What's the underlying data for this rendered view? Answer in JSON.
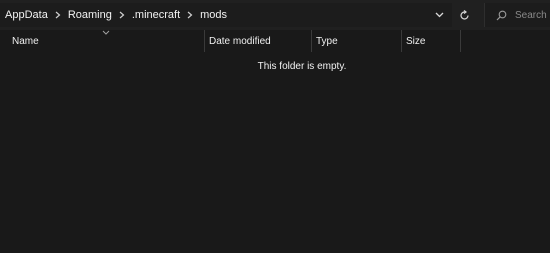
{
  "address_bar": {
    "crumbs": [
      "AppData",
      "Roaming",
      ".minecraft",
      "mods"
    ]
  },
  "search": {
    "placeholder": "Search m"
  },
  "columns": {
    "name": "Name",
    "date_modified": "Date modified",
    "type": "Type",
    "size": "Size"
  },
  "content": {
    "empty_message": "This folder is empty."
  },
  "icons": {
    "separator": "chevron-right-icon",
    "dropdown": "chevron-down-icon",
    "refresh": "refresh-icon",
    "search": "search-icon",
    "sort": "sort-chevron-icon"
  },
  "colors": {
    "background": "#191919",
    "toolbar": "#202020",
    "text": "#ffffff",
    "muted_text": "#8a8a8a"
  }
}
